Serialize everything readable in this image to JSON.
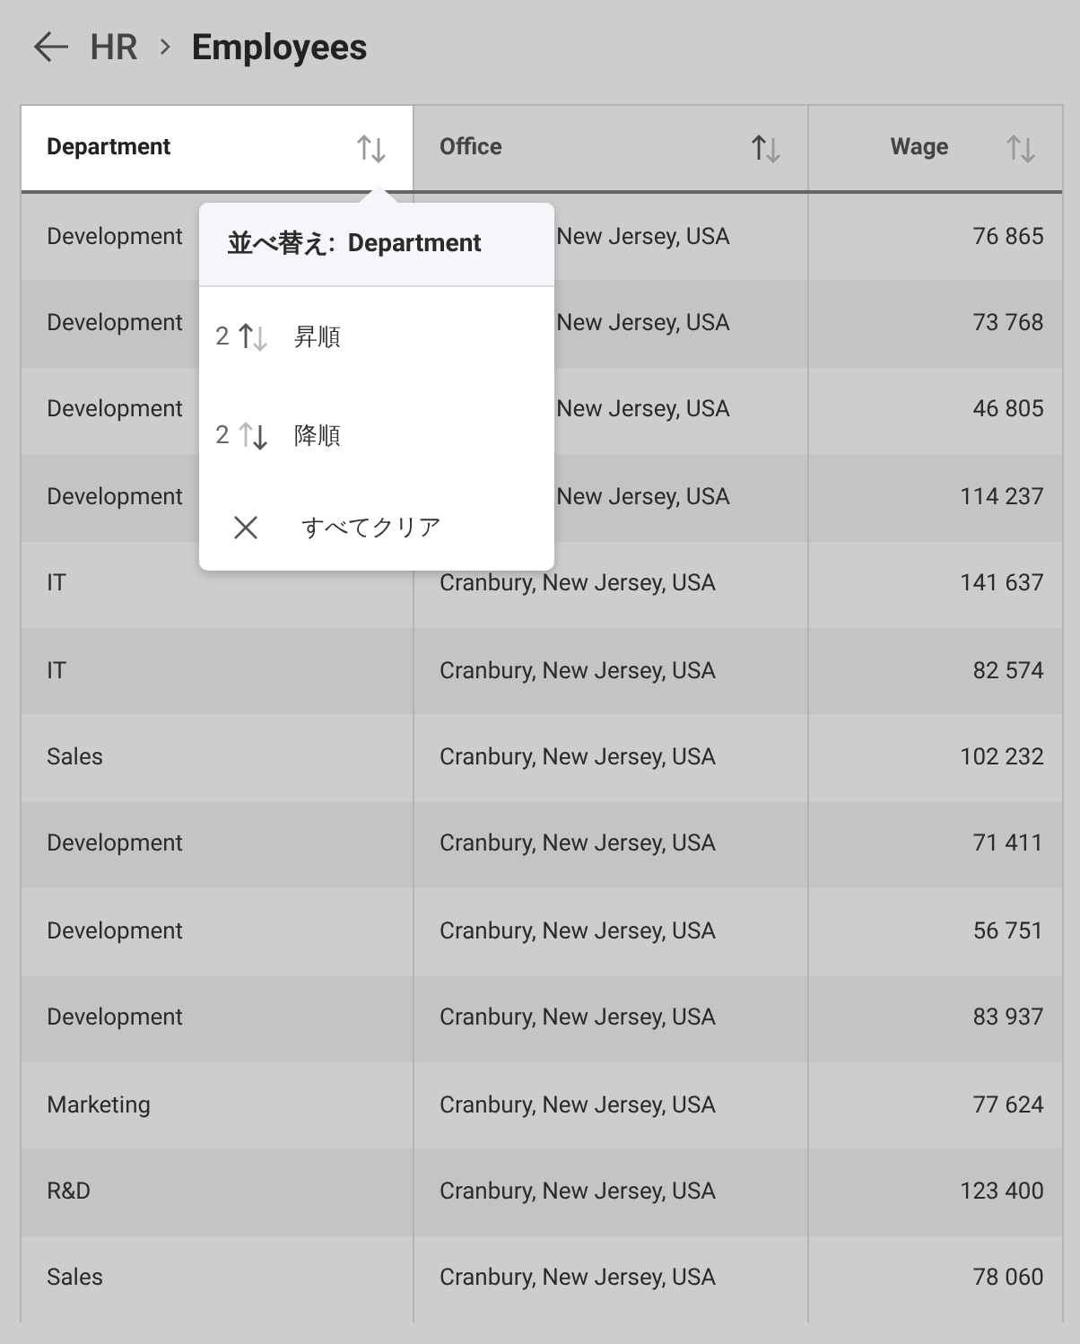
{
  "breadcrumb": {
    "parent": "HR",
    "title": "Employees"
  },
  "table": {
    "columns": [
      {
        "label": "Department",
        "selected": true,
        "sorted_ascending": false
      },
      {
        "label": "Office",
        "selected": false,
        "sorted_ascending": true
      },
      {
        "label": "Wage",
        "selected": false,
        "sorted_ascending": false
      }
    ],
    "rows": [
      {
        "department": "Development",
        "office": "New Jersey, USA",
        "office_under_menu": true,
        "wage": "76 865"
      },
      {
        "department": "Development",
        "office": "New Jersey, USA",
        "office_under_menu": true,
        "wage": "73 768"
      },
      {
        "department": "Development",
        "office": "New Jersey, USA",
        "office_under_menu": true,
        "wage": "46 805"
      },
      {
        "department": "Development",
        "office": "New Jersey, USA",
        "office_under_menu": true,
        "wage": "114 237"
      },
      {
        "department": "IT",
        "office": "Cranbury, New Jersey, USA",
        "office_under_menu": false,
        "wage": "141 637"
      },
      {
        "department": "IT",
        "office": "Cranbury, New Jersey, USA",
        "office_under_menu": false,
        "wage": "82 574"
      },
      {
        "department": "Sales",
        "office": "Cranbury, New Jersey, USA",
        "office_under_menu": false,
        "wage": "102 232"
      },
      {
        "department": "Development",
        "office": "Cranbury, New Jersey, USA",
        "office_under_menu": false,
        "wage": "71 411"
      },
      {
        "department": "Development",
        "office": "Cranbury, New Jersey, USA",
        "office_under_menu": false,
        "wage": "56 751"
      },
      {
        "department": "Development",
        "office": "Cranbury, New Jersey, USA",
        "office_under_menu": false,
        "wage": "83 937"
      },
      {
        "department": "Marketing",
        "office": "Cranbury, New Jersey, USA",
        "office_under_menu": false,
        "wage": "77 624"
      },
      {
        "department": "R&D",
        "office": "Cranbury, New Jersey, USA",
        "office_under_menu": false,
        "wage": "123 400"
      },
      {
        "department": "Sales",
        "office": "Cranbury, New Jersey, USA",
        "office_under_menu": false,
        "wage": "78 060"
      }
    ]
  },
  "sort_menu": {
    "title": "並べ替え:  Department",
    "items": [
      {
        "kind": "asc",
        "index": "2",
        "label": "昇順"
      },
      {
        "kind": "desc",
        "index": "2",
        "label": "降順"
      },
      {
        "kind": "clear",
        "label": "すべてクリア"
      }
    ]
  }
}
